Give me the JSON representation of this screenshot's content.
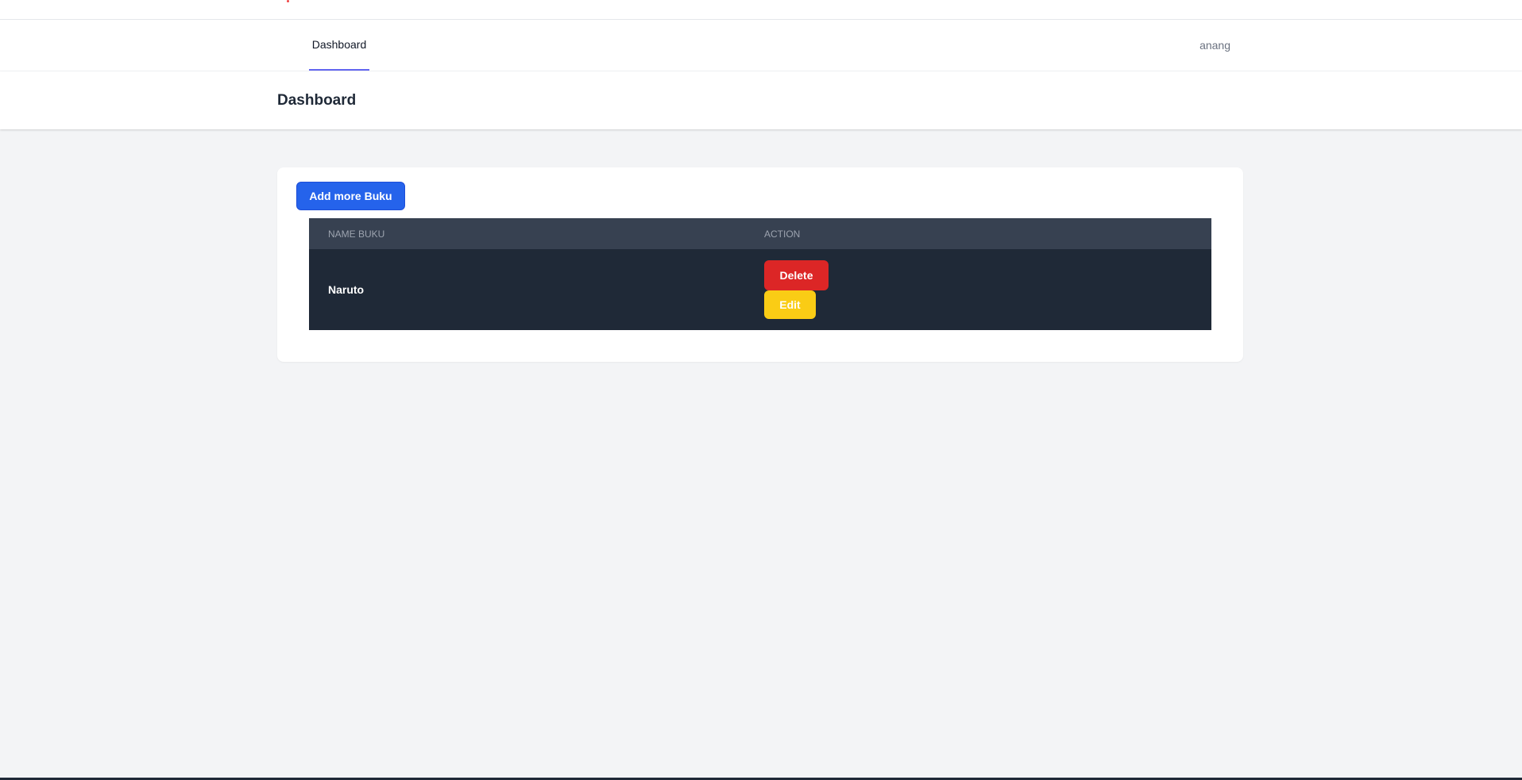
{
  "nav": {
    "links": [
      {
        "label": "Dashboard",
        "active": true
      }
    ],
    "user": "anang"
  },
  "header": {
    "title": "Dashboard"
  },
  "main": {
    "add_button_label": "Add more Buku",
    "table": {
      "columns": [
        "NAME BUKU",
        "ACTION"
      ],
      "rows": [
        {
          "name": "Naruto",
          "actions": {
            "delete_label": "Delete",
            "edit_label": "Edit"
          }
        }
      ]
    }
  },
  "colors": {
    "primary": "#2563eb",
    "danger": "#dc2626",
    "warning": "#facc15",
    "nav_active_underline": "#6366f1",
    "table_header_bg": "#374151",
    "table_row_bg": "#1f2937",
    "page_bg": "#f3f4f6"
  }
}
